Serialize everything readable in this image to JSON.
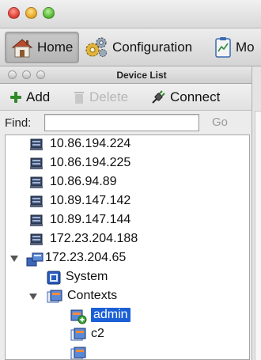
{
  "toolbar": {
    "home_label": "Home",
    "configuration_label": "Configuration",
    "monitoring_label": "Mo"
  },
  "panel": {
    "title": "Device List",
    "add_label": "Add",
    "delete_label": "Delete",
    "connect_label": "Connect",
    "find_label": "Find:",
    "find_value": "",
    "go_label": "Go"
  },
  "tree": {
    "devices": [
      "10.86.194.224",
      "10.86.194.225",
      "10.86.94.89",
      "10.89.147.142",
      "10.89.147.144",
      "172.23.204.188"
    ],
    "expanded_device": "172.23.204.65",
    "system_label": "System",
    "contexts_label": "Contexts",
    "context_items": [
      "admin",
      "c2"
    ],
    "selected": "admin"
  },
  "colors": {
    "selection": "#1a5fd6",
    "close": "#e0443a",
    "minimize": "#e8a92a",
    "maximize": "#5dbb3a"
  }
}
